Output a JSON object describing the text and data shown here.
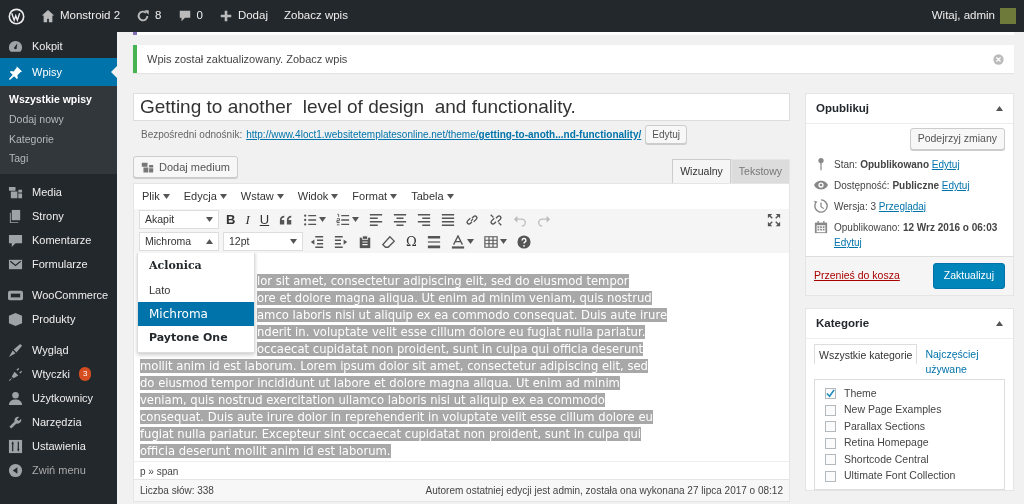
{
  "admin_bar": {
    "site": "Monstroid 2",
    "updates": "8",
    "comments": "0",
    "new": "Dodaj",
    "view": "Zobacz wpis",
    "greeting": "Witaj, admin"
  },
  "sidebar": {
    "items": [
      {
        "label": "Kokpit",
        "selected": false
      },
      {
        "label": "Wpisy",
        "selected": true,
        "children": [
          {
            "label": "Wszystkie wpisy",
            "selected": true
          },
          {
            "label": "Dodaj nowy",
            "selected": false
          },
          {
            "label": "Kategorie",
            "selected": false
          },
          {
            "label": "Tagi",
            "selected": false
          }
        ]
      },
      {
        "label": "Media",
        "selected": false
      },
      {
        "label": "Strony",
        "selected": false
      },
      {
        "label": "Komentarze",
        "selected": false
      },
      {
        "label": "Formularze",
        "selected": false
      },
      {
        "label": "WooCommerce",
        "selected": false,
        "separator_before": true
      },
      {
        "label": "Produkty",
        "selected": false
      },
      {
        "label": "Wygląd",
        "selected": false,
        "separator_before": true
      },
      {
        "label": "Wtyczki",
        "selected": false,
        "badge": "3"
      },
      {
        "label": "Użytkownicy",
        "selected": false
      },
      {
        "label": "Narzędzia",
        "selected": false
      },
      {
        "label": "Ustawienia",
        "selected": false
      }
    ],
    "collapse": "Zwiń menu"
  },
  "notice": {
    "text": "Wpis został zaktualizowany.",
    "link": "Zobacz wpis"
  },
  "post": {
    "title": "Getting to another  level of design  and functionality.",
    "permalink_label": "Bezpośredni odnośnik:",
    "permalink": "http://www.4loct1.websitetemplatesonline.net/theme/**getting-to-anoth...nd-functionality/**",
    "edit": "Edytuj"
  },
  "editor": {
    "add_media": "Dodaj medium",
    "tabs": [
      {
        "label": "Wizualny",
        "selected": true
      },
      {
        "label": "Tekstowy",
        "selected": false
      }
    ],
    "menus": [
      "Plik",
      "Edycja",
      "Wstaw",
      "Widok",
      "Format",
      "Tabela"
    ],
    "toolbar1": [
      {
        "kind": "select",
        "label": "Akapit",
        "expanded": false
      },
      {
        "kind": "letter",
        "label": "B"
      },
      {
        "kind": "letter",
        "label": "I"
      },
      {
        "kind": "letter",
        "label": "U"
      },
      {
        "kind": "icon"
      },
      {
        "kind": "split"
      },
      {
        "kind": "split"
      },
      {
        "kind": "icon"
      },
      {
        "kind": "icon"
      },
      {
        "kind": "icon"
      },
      {
        "kind": "icon"
      },
      {
        "kind": "icon"
      },
      {
        "kind": "icon"
      },
      {
        "kind": "icon",
        "disabled": true
      },
      {
        "kind": "icon",
        "disabled": true
      },
      {
        "kind": "icon"
      }
    ],
    "toolbar2": [
      {
        "kind": "select",
        "label": "Michroma",
        "expanded": true
      },
      {
        "kind": "select",
        "label": "12pt",
        "expanded": false
      },
      {
        "kind": "icon"
      },
      {
        "kind": "icon"
      },
      {
        "kind": "icon"
      },
      {
        "kind": "icon"
      },
      {
        "kind": "letter",
        "label": "Ω"
      },
      {
        "kind": "icon"
      },
      {
        "kind": "split"
      },
      {
        "kind": "split"
      },
      {
        "kind": "icon"
      }
    ],
    "font_menu": [
      {
        "label": "Aclonica",
        "selected": false
      },
      {
        "label": "Lato",
        "selected": false
      },
      {
        "label": "Michroma",
        "selected": true
      },
      {
        "label": "Paytone One",
        "selected": false
      }
    ],
    "lines": [
      "lor sit amet, consectetur adipiscing elit, sed do eiusmod tempor",
      "ore et dolore magna aliqua. Ut enim ad minim veniam, quis nostrud",
      "amco laboris nisi ut aliquip ex ea commodo consequat. Duis aute irure",
      "nderit in. voluptate velit esse cillum dolore eu fugiat nulla pariatur.",
      "occaecat cupidatat non proident, sunt in culpa qui officia deserunt",
      "mollit anim id est laborum. Lorem ipsum dolor sit amet, consectetur adipiscing elit, sed",
      "do eiusmod tempor incididunt ut labore et dolore magna aliqua. Ut enim ad minim",
      "veniam, quis nostrud exercitation ullamco laboris nisi ut aliquip ex ea commodo",
      "consequat. Duis aute irure dolor in reprehenderit in voluptate velit esse cillum dolore eu",
      "fugiat nulla pariatur. Excepteur sint occaecat cupidatat non proident, sunt in culpa qui",
      "officia deserunt mollit anim id est laborum."
    ],
    "path": "p » span",
    "word_count": "Liczba słów: 338",
    "last_edit": "Autorem ostatniej edycji jest admin, została ona wykonana 27 lipca 2017 o 08:12"
  },
  "publish": {
    "title": "Opublikuj",
    "preview": "Podejrzyj zmiany",
    "rows": [
      {
        "text": "Stan: **Opublikowano**",
        "link": "Edytuj"
      },
      {
        "text": "Dostępność: **Publiczne**",
        "link": "Edytuj"
      },
      {
        "text": "Wersja: 3",
        "link": "Przeglądaj"
      },
      {
        "text": "Opublikowano: **12 Wrz 2016 o 06:03**",
        "link": "Edytuj"
      }
    ],
    "trash": "Przenieś do kosza",
    "update": "Zaktualizuj"
  },
  "categories": {
    "title": "Kategorie",
    "tabs": [
      {
        "label": "Wszystkie kategorie",
        "selected": true
      },
      {
        "label": "Najczęściej używane",
        "selected": false
      }
    ],
    "items": [
      {
        "label": "Theme",
        "checked": true
      },
      {
        "label": "New Page Examples",
        "checked": false
      },
      {
        "label": "Parallax Sections",
        "checked": false
      },
      {
        "label": "Retina Homepage",
        "checked": false
      },
      {
        "label": "Shortcode Central",
        "checked": false
      },
      {
        "label": "Ultimate Font Collection",
        "checked": false
      }
    ]
  }
}
